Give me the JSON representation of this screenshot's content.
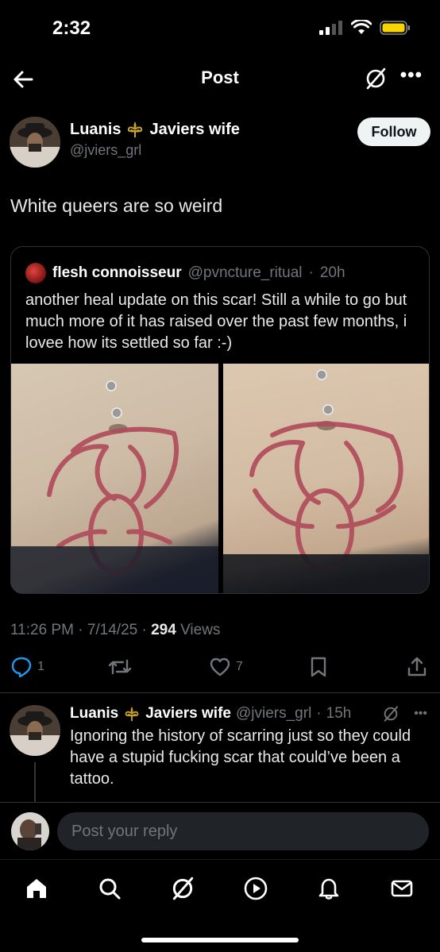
{
  "status_bar": {
    "time": "2:32"
  },
  "nav": {
    "title": "Post",
    "more": "•••"
  },
  "post": {
    "author_name": "Luanis",
    "author_name_suffix": "Javiers wife",
    "handle": "@jviers_grl",
    "follow_label": "Follow",
    "text": "White queers are so weird",
    "time": "11:26 PM",
    "date": "7/14/25",
    "views_count": "294",
    "views_label": "Views",
    "reply_count": "1",
    "like_count": "7"
  },
  "quote": {
    "name": "flesh connoisseur",
    "handle": "@pvncture_ritual",
    "age": "20h",
    "text": "another heal update on this scar! Still a while to go but much more of it has raised over the past few months, i lovee how its settled so far :-)"
  },
  "reply": {
    "author_name": "Luanis",
    "author_name_suffix": "Javiers wife",
    "handle": "@jviers_grl",
    "age": "15h",
    "text": "Ignoring the history of scarring just so they could have a stupid fucking scar that could’ve been a tattoo."
  },
  "reply_bar": {
    "placeholder": "Post your reply"
  },
  "colors": {
    "background": "#000000",
    "text_primary": "#e7e9ea",
    "text_secondary": "#71767b",
    "border": "#2f3336",
    "scar": "#b04a5a",
    "follow_button": "#eff3f4"
  },
  "icons": {
    "back": "arrow-left-icon",
    "grok": "grok-icon",
    "more": "more-horizontal-icon",
    "fleur": "fleur-de-lis-icon",
    "reply": "reply-icon",
    "retweet": "retweet-icon",
    "like": "heart-icon",
    "bookmark": "bookmark-icon",
    "share": "share-icon",
    "tabs": [
      "home-icon",
      "search-icon",
      "grok-icon",
      "video-icon",
      "bell-icon",
      "mail-icon"
    ]
  }
}
